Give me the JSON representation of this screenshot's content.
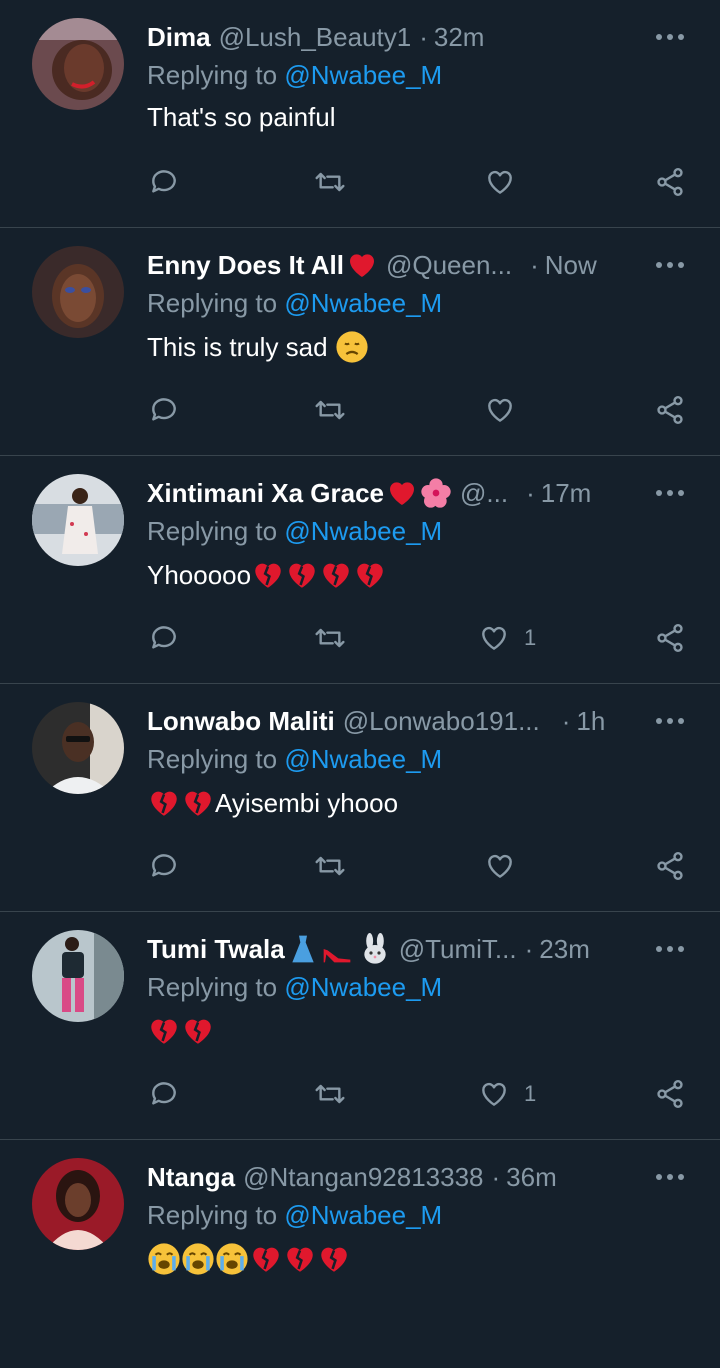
{
  "theme": {
    "background": "#15202b",
    "text": "#ffffff",
    "muted": "#8899a6",
    "link": "#1d9bf0",
    "divider": "#38444d"
  },
  "replying_prefix": "Replying to ",
  "tweets": [
    {
      "name": "Dima",
      "handle": "@Lush_Beauty1",
      "separator": "·",
      "time": "32m",
      "reply_to": "@Nwabee_M",
      "text": "That's so painful",
      "likes": "",
      "name_emojis": [],
      "text_emojis": []
    },
    {
      "name": "Enny Does It All",
      "handle": "@Queen...",
      "separator": "·",
      "time": "Now",
      "reply_to": "@Nwabee_M",
      "text": "This is truly sad ",
      "likes": "",
      "name_emojis": [
        "red-heart"
      ],
      "text_emojis": [
        "disappointed-face"
      ]
    },
    {
      "name": "Xintimani Xa Grace",
      "handle": "@...",
      "separator": "·",
      "time": "17m",
      "reply_to": "@Nwabee_M",
      "text": "Yhooooo",
      "likes": "1",
      "name_emojis": [
        "red-heart",
        "hibiscus"
      ],
      "text_emojis": [
        "broken-heart",
        "broken-heart",
        "broken-heart",
        "broken-heart"
      ]
    },
    {
      "name": "Lonwabo Maliti",
      "handle": "@Lonwabo191...",
      "separator": "·",
      "time": "1h",
      "reply_to": "@Nwabee_M",
      "text": "Ayisembi yhooo",
      "likes": "",
      "name_emojis": [],
      "text_emojis": [
        "broken-heart",
        "broken-heart"
      ],
      "emoji_first": true
    },
    {
      "name": "Tumi Twala",
      "handle": "@TumiT...",
      "separator": "·",
      "time": "23m",
      "reply_to": "@Nwabee_M",
      "text": "",
      "likes": "1",
      "name_emojis": [
        "dress",
        "high-heel",
        "rabbit-face"
      ],
      "text_emojis": [
        "broken-heart",
        "broken-heart"
      ]
    },
    {
      "name": "Ntanga",
      "handle": "@Ntangan92813338",
      "separator": "·",
      "time": "36m",
      "reply_to": "@Nwabee_M",
      "text": "",
      "likes": "",
      "name_emojis": [],
      "text_emojis": [
        "crying-face",
        "crying-face",
        "crying-face",
        "broken-heart",
        "broken-heart",
        "broken-heart"
      ]
    }
  ]
}
